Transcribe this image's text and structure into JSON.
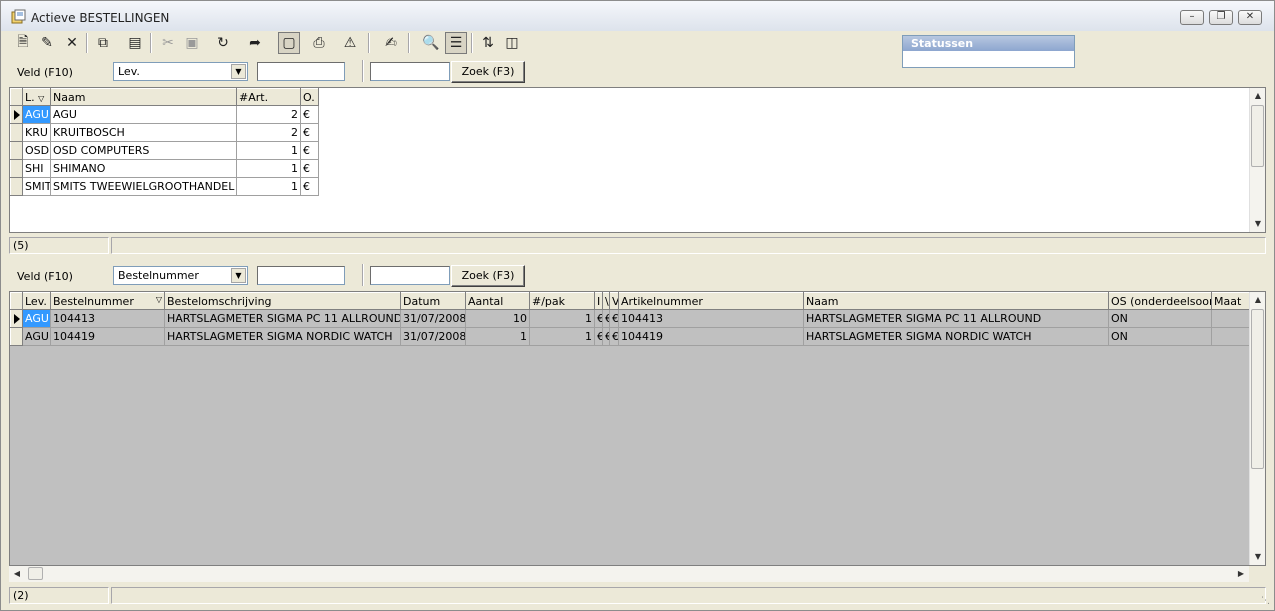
{
  "window": {
    "title": "Actieve BESTELLINGEN",
    "controls": [
      "minimize",
      "restore",
      "close"
    ]
  },
  "toolbar": {
    "icons": [
      "new-icon",
      "edit-icon",
      "delete-icon",
      "copy-icon",
      "properties-icon",
      "cut-icon",
      "save-icon",
      "refresh-icon",
      "import-icon",
      "card-icon",
      "print-icon",
      "alert-icon",
      "pencil-icon",
      "find-icon",
      "list-icon",
      "sort-icon",
      "columns-icon"
    ]
  },
  "status_panel": {
    "title": "Statussen"
  },
  "top_search": {
    "label": "Veld (F10)",
    "field_value": "Lev.",
    "search_button": "Zoek (F3)"
  },
  "suppliers_grid": {
    "columns": [
      "L.",
      "Naam",
      "#Art.",
      "O."
    ],
    "rows": [
      {
        "code": "AGU",
        "name": "AGU",
        "art": "2",
        "o": "€"
      },
      {
        "code": "KRU",
        "name": "KRUITBOSCH",
        "art": "2",
        "o": "€"
      },
      {
        "code": "OSD",
        "name": "OSD COMPUTERS",
        "art": "1",
        "o": "€"
      },
      {
        "code": "SHI",
        "name": "SHIMANO",
        "art": "1",
        "o": "€"
      },
      {
        "code": "SMIT",
        "name": "SMITS TWEEWIELGROOTHANDEL",
        "art": "1",
        "o": "€"
      }
    ],
    "count": "(5)"
  },
  "bottom_search": {
    "label": "Veld (F10)",
    "field_value": "Bestelnummer",
    "search_button": "Zoek (F3)"
  },
  "orders_grid": {
    "columns": [
      "Lev.",
      "Bestelnummer",
      "Bestelomschrijving",
      "Datum",
      "Aantal",
      "#/pak",
      "I",
      "\\",
      "V",
      "Artikelnummer",
      "Naam",
      "OS (onderdeelsoort)",
      "Maat"
    ],
    "rows": [
      {
        "lev": "AGU",
        "bestelnummer": "104413",
        "omschrijving": "HARTSLAGMETER SIGMA PC 11 ALLROUND",
        "datum": "31/07/2008",
        "aantal": "10",
        "pak": "1",
        "i": "€",
        "b": "€",
        "v": "€",
        "artikelnummer": "104413",
        "naam": "HARTSLAGMETER SIGMA PC 11 ALLROUND",
        "os": "ON",
        "maat": ""
      },
      {
        "lev": "AGU",
        "bestelnummer": "104419",
        "omschrijving": "HARTSLAGMETER SIGMA NORDIC WATCH",
        "datum": "31/07/2008",
        "aantal": "1",
        "pak": "1",
        "i": "€",
        "b": "€",
        "v": "€",
        "artikelnummer": "104419",
        "naam": "HARTSLAGMETER SIGMA NORDIC WATCH",
        "os": "ON",
        "maat": ""
      }
    ],
    "count": "(2)"
  },
  "colors": {
    "selection": "#3399ff",
    "grid_gray": "#c0c0c0",
    "panel": "#ece9d8"
  }
}
